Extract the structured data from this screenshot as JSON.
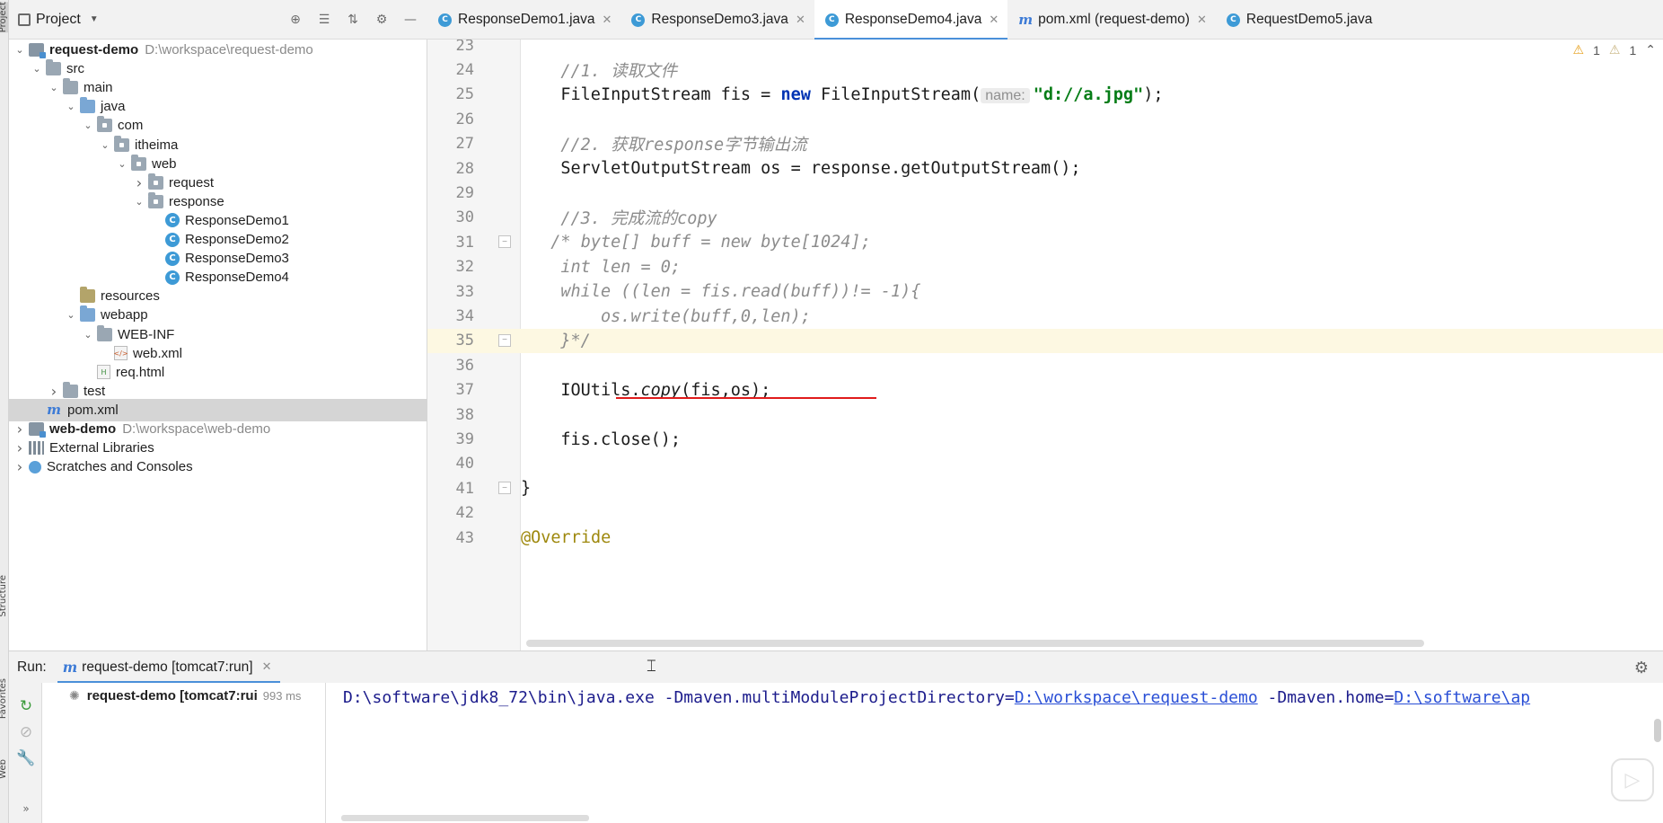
{
  "project_panel": {
    "title": "Project",
    "tree": [
      {
        "arrow": "v",
        "icon": "module-icon",
        "name": "request-demo",
        "path": "D:\\workspace\\request-demo",
        "bold": true
      },
      {
        "arrow": "v",
        "icon": "folder-icon",
        "name": "src",
        "path": ""
      },
      {
        "arrow": "v",
        "icon": "folder-icon",
        "name": "main",
        "path": ""
      },
      {
        "arrow": "v",
        "icon": "source-folder-icon",
        "name": "java",
        "path": ""
      },
      {
        "arrow": "v",
        "icon": "package-icon",
        "name": "com",
        "path": ""
      },
      {
        "arrow": "v",
        "icon": "package-icon",
        "name": "itheima",
        "path": ""
      },
      {
        "arrow": "v",
        "icon": "package-icon",
        "name": "web",
        "path": ""
      },
      {
        "arrow": ">",
        "icon": "package-icon",
        "name": "request",
        "path": ""
      },
      {
        "arrow": "v",
        "icon": "package-icon",
        "name": "response",
        "path": ""
      },
      {
        "arrow": "",
        "icon": "class-icon",
        "name": "ResponseDemo1",
        "path": ""
      },
      {
        "arrow": "",
        "icon": "class-icon",
        "name": "ResponseDemo2",
        "path": ""
      },
      {
        "arrow": "",
        "icon": "class-icon",
        "name": "ResponseDemo3",
        "path": ""
      },
      {
        "arrow": "",
        "icon": "class-icon",
        "name": "ResponseDemo4",
        "path": ""
      },
      {
        "arrow": "",
        "icon": "resources-folder-icon",
        "name": "resources",
        "path": ""
      },
      {
        "arrow": "v",
        "icon": "web-folder-icon",
        "name": "webapp",
        "path": ""
      },
      {
        "arrow": "v",
        "icon": "folder-icon",
        "name": "WEB-INF",
        "path": ""
      },
      {
        "arrow": "",
        "icon": "xml-file-icon",
        "name": "web.xml",
        "path": ""
      },
      {
        "arrow": "",
        "icon": "html-file-icon",
        "name": "req.html",
        "path": ""
      },
      {
        "arrow": ">",
        "icon": "folder-icon",
        "name": "test",
        "path": ""
      },
      {
        "arrow": "",
        "icon": "maven-icon",
        "name": "pom.xml",
        "path": "",
        "selected": true
      },
      {
        "arrow": ">",
        "icon": "module-icon",
        "name": "web-demo",
        "path": "D:\\workspace\\web-demo",
        "bold": true
      },
      {
        "arrow": ">",
        "icon": "library-icon",
        "name": "External Libraries",
        "path": ""
      },
      {
        "arrow": ">",
        "icon": "scratch-icon",
        "name": "Scratches and Consoles",
        "path": ""
      }
    ]
  },
  "editor_tabs": [
    {
      "label": "ResponseDemo1.java",
      "icon": "class-icon",
      "active": false,
      "closable": true
    },
    {
      "label": "ResponseDemo3.java",
      "icon": "class-icon",
      "active": false,
      "closable": true
    },
    {
      "label": "ResponseDemo4.java",
      "icon": "class-icon",
      "active": true,
      "closable": true
    },
    {
      "label": "pom.xml (request-demo)",
      "icon": "maven-icon",
      "active": false,
      "closable": true
    },
    {
      "label": "RequestDemo5.java",
      "icon": "class-icon",
      "active": false,
      "closable": false
    }
  ],
  "editor": {
    "warnings": {
      "count_a": "1",
      "count_b": "1"
    },
    "current_line": 35,
    "lines": [
      {
        "n": "23",
        "html": ""
      },
      {
        "n": "24",
        "html": "<span class=\"cm-gray\">//1. 读取文件</span>"
      },
      {
        "n": "25",
        "html": "FileInputStream fis = <span class=\"kw\">new</span> FileInputStream(<span class=\"hint\">name:</span><span class=\"str\">\"d://a.jpg\"</span>);"
      },
      {
        "n": "26",
        "html": ""
      },
      {
        "n": "27",
        "html": "<span class=\"cm-gray\">//2. 获取response字节输出流</span>"
      },
      {
        "n": "28",
        "html": "ServletOutputStream os = response.getOutputStream();"
      },
      {
        "n": "29",
        "html": ""
      },
      {
        "n": "30",
        "html": "<span class=\"cm-gray\">//3. 完成流的copy</span>"
      },
      {
        "n": "31",
        "html": "<span class=\"cm-gray\">/* byte[] buff = new byte[1024];</span>",
        "indent": -1
      },
      {
        "n": "32",
        "html": "<span class=\"cm-gray\">int len = 0;</span>"
      },
      {
        "n": "33",
        "html": "<span class=\"cm-gray\">while ((len = fis.read(buff))!= -1){</span>"
      },
      {
        "n": "34",
        "html": "<span class=\"cm-gray\">    os.write(buff,0,len);</span>"
      },
      {
        "n": "35",
        "html": "<span class=\"cm-gray\">}*/</span>"
      },
      {
        "n": "36",
        "html": ""
      },
      {
        "n": "37",
        "html": "IOUtils.<span class=\"ital\">copy</span>(fis,os);"
      },
      {
        "n": "38",
        "html": ""
      },
      {
        "n": "39",
        "html": "fis.close();"
      },
      {
        "n": "40",
        "html": ""
      },
      {
        "n": "41",
        "html": "}",
        "indent": -4
      },
      {
        "n": "42",
        "html": ""
      },
      {
        "n": "43",
        "html": "<span class=\"anno\">@Override</span>",
        "indent": -4
      }
    ]
  },
  "run_panel": {
    "label": "Run:",
    "tab_label": "request-demo [tomcat7:run]",
    "node_label": "request-demo [tomcat7:rui",
    "node_time": "993 ms",
    "console": {
      "prefix": "D:\\software\\jdk8_72\\bin\\java.exe -Dmaven.multiModuleProjectDirectory=",
      "link1": "D:\\workspace\\request-demo",
      "middle": " -Dmaven.home=",
      "link2": "D:\\software\\ap"
    }
  },
  "side_stripe": {
    "project": "Project",
    "structure": "Structure",
    "favorites": "Favorites",
    "web": "Web"
  }
}
